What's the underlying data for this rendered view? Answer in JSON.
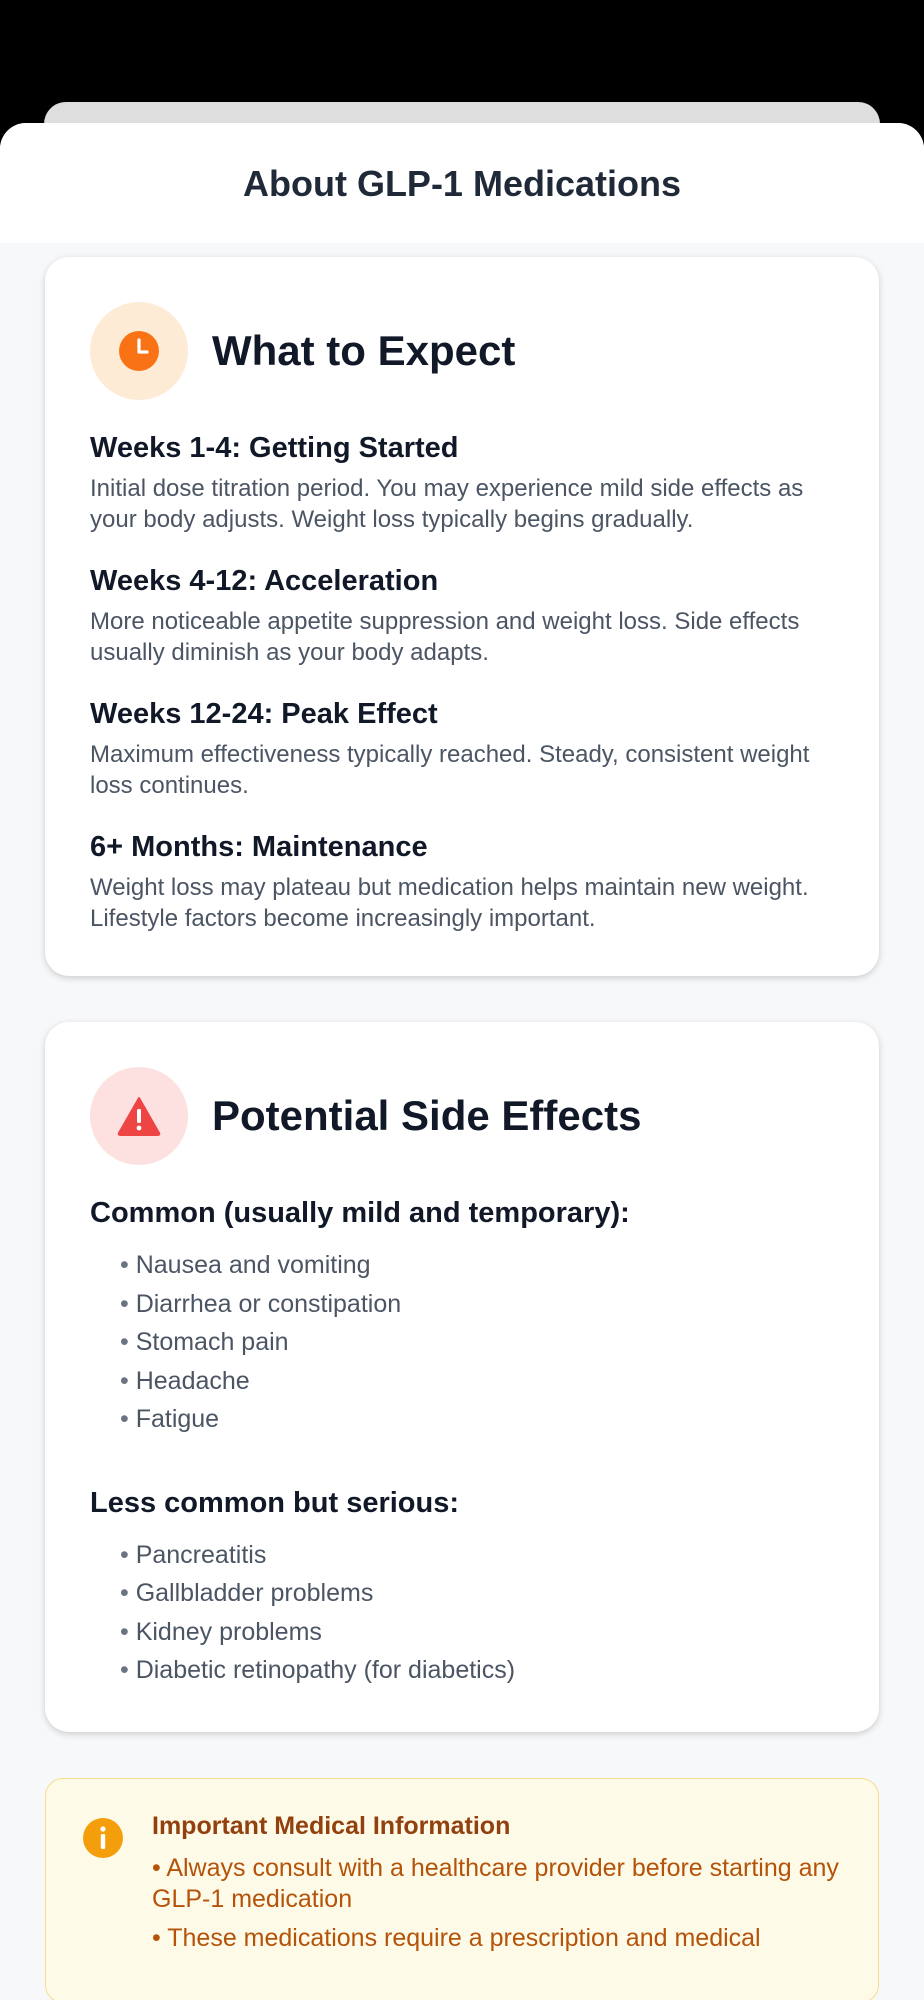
{
  "header": {
    "title": "About GLP-1 Medications"
  },
  "expect_card": {
    "icon": "clock-icon",
    "title": "What to Expect",
    "stages": [
      {
        "title": "Weeks 1-4: Getting Started",
        "desc": "Initial dose titration period. You may experience mild side effects as your body adjusts. Weight loss typically begins gradually."
      },
      {
        "title": "Weeks 4-12: Acceleration",
        "desc": "More noticeable appetite suppression and weight loss. Side effects usually diminish as your body adapts."
      },
      {
        "title": "Weeks 12-24: Peak Effect",
        "desc": "Maximum effectiveness typically reached. Steady, consistent weight loss continues."
      },
      {
        "title": "6+ Months: Maintenance",
        "desc": "Weight loss may plateau but medication helps maintain new weight. Lifestyle factors become increasingly important."
      }
    ]
  },
  "side_effects_card": {
    "icon": "warning-icon",
    "title": "Potential Side Effects",
    "common": {
      "heading": "Common (usually mild and temporary):",
      "items": [
        "Nausea and vomiting",
        "Diarrhea or constipation",
        "Stomach pain",
        "Headache",
        "Fatigue"
      ]
    },
    "serious": {
      "heading": "Less common but serious:",
      "items": [
        "Pancreatitis",
        "Gallbladder problems",
        "Kidney problems",
        "Diabetic retinopathy (for diabetics)"
      ]
    }
  },
  "info_box": {
    "icon": "info-icon",
    "title": "Important Medical Information",
    "items": [
      "• Always consult with a healthcare provider before starting any GLP-1 medication",
      "• These medications require a prescription and medical"
    ]
  },
  "colors": {
    "accent_orange": "#f97316",
    "warning_red": "#ef4444",
    "info_amber": "#f59e0b"
  }
}
